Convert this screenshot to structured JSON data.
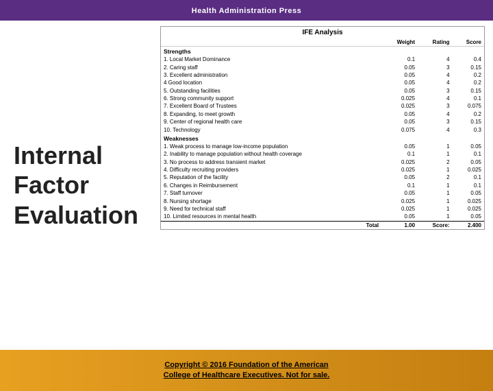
{
  "header": {
    "title": "Health Administration Press"
  },
  "left_panel": {
    "title_line1": "Internal Factor",
    "title_line2": "Evaluation"
  },
  "table": {
    "title": "IFE Analysis",
    "columns": [
      "",
      "Weight",
      "Rating",
      "Score"
    ],
    "strengths_label": "Strengths",
    "strengths": [
      {
        "num": "1.",
        "name": "Local Market Dominance",
        "weight": "0.1",
        "rating": "4",
        "score": "0.4"
      },
      {
        "num": "2.",
        "name": "Caring staff",
        "weight": "0.05",
        "rating": "3",
        "score": "0.15"
      },
      {
        "num": "3.",
        "name": "Excellent administration",
        "weight": "0.05",
        "rating": "4",
        "score": "0.2"
      },
      {
        "num": "4",
        "name": "Good location",
        "weight": "0.05",
        "rating": "4",
        "score": "0.2"
      },
      {
        "num": "5.",
        "name": "Outstanding facilities",
        "weight": "0.05",
        "rating": "3",
        "score": "0.15"
      },
      {
        "num": "6.",
        "name": "Strong community support",
        "weight": "0.025",
        "rating": "4",
        "score": "0.1"
      },
      {
        "num": "7.",
        "name": "Excellent Board of Trustees",
        "weight": "0.025",
        "rating": "3",
        "score": "0.075"
      },
      {
        "num": "8.",
        "name": "Expanding, to meet growth",
        "weight": "0.05",
        "rating": "4",
        "score": "0.2"
      },
      {
        "num": "9.",
        "name": "Center of regional health care",
        "weight": "0.05",
        "rating": "3",
        "score": "0.15"
      },
      {
        "num": "10.",
        "name": "Technology",
        "weight": "0.075",
        "rating": "4",
        "score": "0.3"
      }
    ],
    "weaknesses_label": "Weaknesses",
    "weaknesses": [
      {
        "num": "1.",
        "name": "Weak process to manage low-income population",
        "weight": "0.05",
        "rating": "1",
        "score": "0.05"
      },
      {
        "num": "2.",
        "name": "Inability to manage population without health coverage",
        "weight": "0.1",
        "rating": "1",
        "score": "0.1"
      },
      {
        "num": "3.",
        "name": "No process to address transient market",
        "weight": "0.025",
        "rating": "2",
        "score": "0.05"
      },
      {
        "num": "4.",
        "name": "Difficulty recruiting providers",
        "weight": "0.025",
        "rating": "1",
        "score": "0.025"
      },
      {
        "num": "5.",
        "name": "Reputation of the facility",
        "weight": "0.05",
        "rating": "2",
        "score": "0.1"
      },
      {
        "num": "6.",
        "name": "Changes in Reimbursement",
        "weight": "0.1",
        "rating": "1",
        "score": "0.1"
      },
      {
        "num": "7.",
        "name": "Staff turnover",
        "weight": "0.05",
        "rating": "1",
        "score": "0.05"
      },
      {
        "num": "8.",
        "name": "Nursing shortage",
        "weight": "0.025",
        "rating": "1",
        "score": "0.025"
      },
      {
        "num": "9.",
        "name": "Need for technical staff",
        "weight": "0.025",
        "rating": "1",
        "score": "0.025"
      },
      {
        "num": "10.",
        "name": "Limited resources in mental health",
        "weight": "0.05",
        "rating": "1",
        "score": "0.05"
      }
    ],
    "total": {
      "label": "Total",
      "weight": "1.00",
      "score_label": "Score:",
      "score": "2.400"
    }
  },
  "footer": {
    "line1": "Copyright © 2016 Foundation of the American",
    "line2": "College of Healthcare Executives. Not for sale."
  }
}
